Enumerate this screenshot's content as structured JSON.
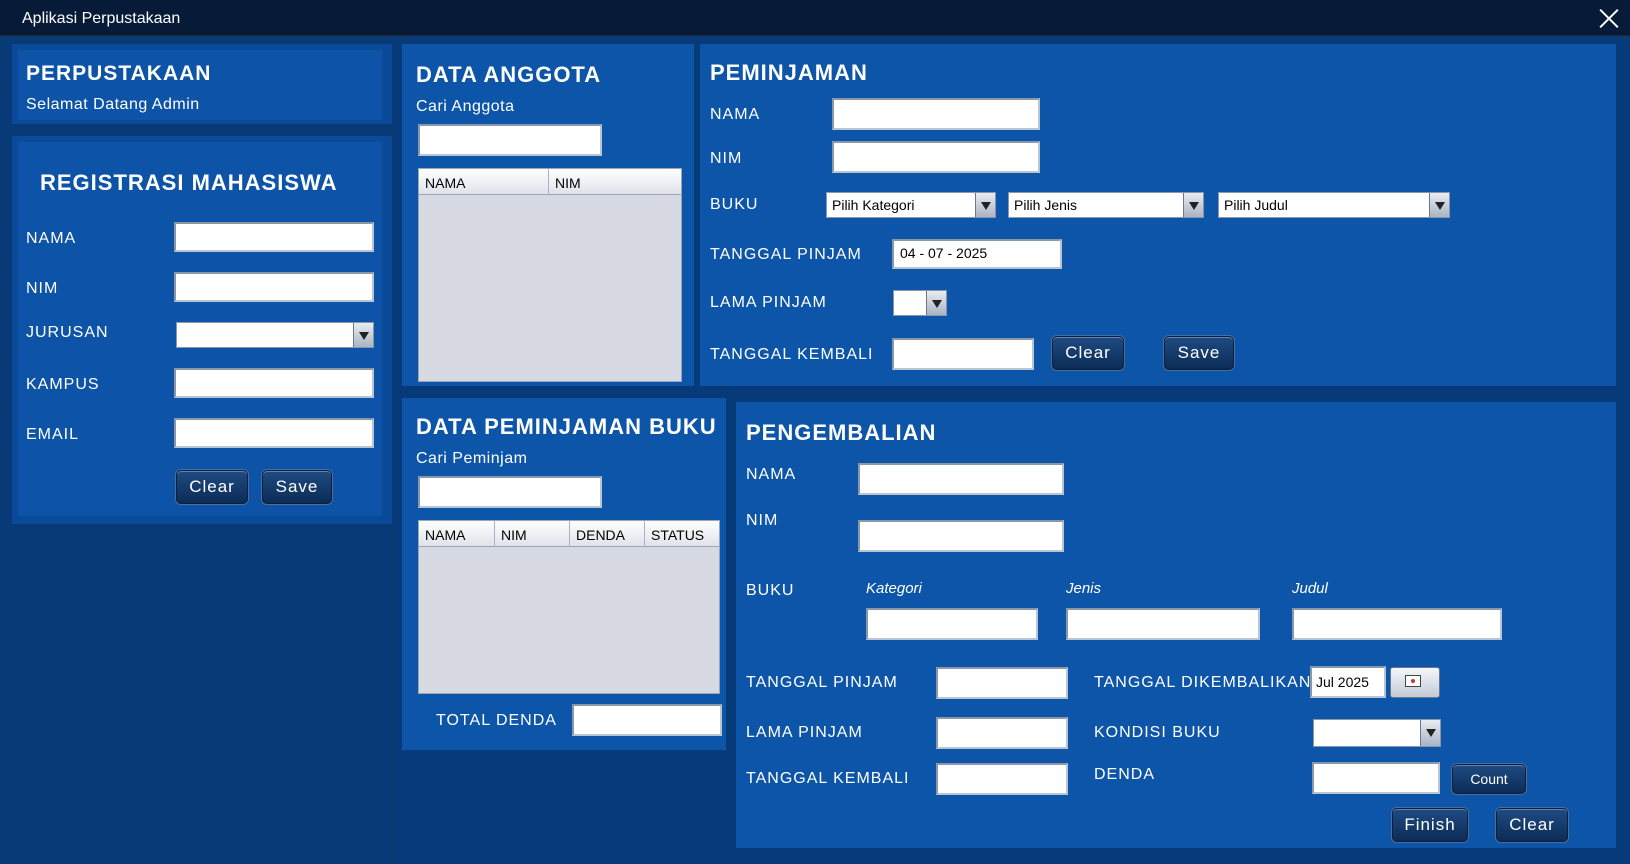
{
  "window": {
    "title": "Aplikasi Perpustakaan"
  },
  "header": {
    "title": "PERPUSTAKAAN",
    "welcome": "Selamat Datang Admin"
  },
  "registrasi": {
    "title": "REGISTRASI MAHASISWA",
    "nama_label": "NAMA",
    "nim_label": "NIM",
    "jurusan_label": "JURUSAN",
    "kampus_label": "KAMPUS",
    "email_label": "EMAIL",
    "clear_label": "Clear",
    "save_label": "Save"
  },
  "anggota": {
    "title": "DATA ANGGOTA",
    "search_label": "Cari Anggota",
    "columns": [
      "NAMA",
      "NIM"
    ]
  },
  "peminjaman": {
    "title": "PEMINJAMAN",
    "nama_label": "NAMA",
    "nim_label": "NIM",
    "buku_label": "BUKU",
    "kategori_value": "Pilih Kategori",
    "jenis_value": "Pilih Jenis",
    "judul_value": "Pilih Judul",
    "tanggal_pinjam_label": "TANGGAL PINJAM",
    "tanggal_pinjam_value": "04 - 07 - 2025",
    "lama_pinjam_label": "LAMA PINJAM",
    "tanggal_kembali_label": "TANGGAL KEMBALI",
    "clear_label": "Clear",
    "save_label": "Save"
  },
  "data_peminjaman": {
    "title": "DATA PEMINJAMAN BUKU",
    "search_label": "Cari Peminjam",
    "columns": [
      "NAMA",
      "NIM",
      "DENDA",
      "STATUS"
    ],
    "total_denda_label": "TOTAL DENDA"
  },
  "pengembalian": {
    "title": "PENGEMBALIAN",
    "nama_label": "NAMA",
    "nim_label": "NIM",
    "buku_label": "BUKU",
    "kategori_label": "Kategori",
    "jenis_label": "Jenis",
    "judul_label": "Judul",
    "tanggal_pinjam_label": "TANGGAL PINJAM",
    "lama_pinjam_label": "LAMA PINJAM",
    "tanggal_kembali_label": "TANGGAL KEMBALI",
    "tanggal_dikembalikan_label": "TANGGAL DIKEMBALIKAN",
    "tanggal_dikembalikan_value": "Jul 2025",
    "kondisi_label": "KONDISI BUKU",
    "denda_label": "DENDA",
    "count_label": "Count",
    "finish_label": "Finish",
    "clear_label": "Clear"
  },
  "icons": {
    "close": "close-icon",
    "calendar": "calendar-icon",
    "dropdown": "chevron-down-icon"
  }
}
